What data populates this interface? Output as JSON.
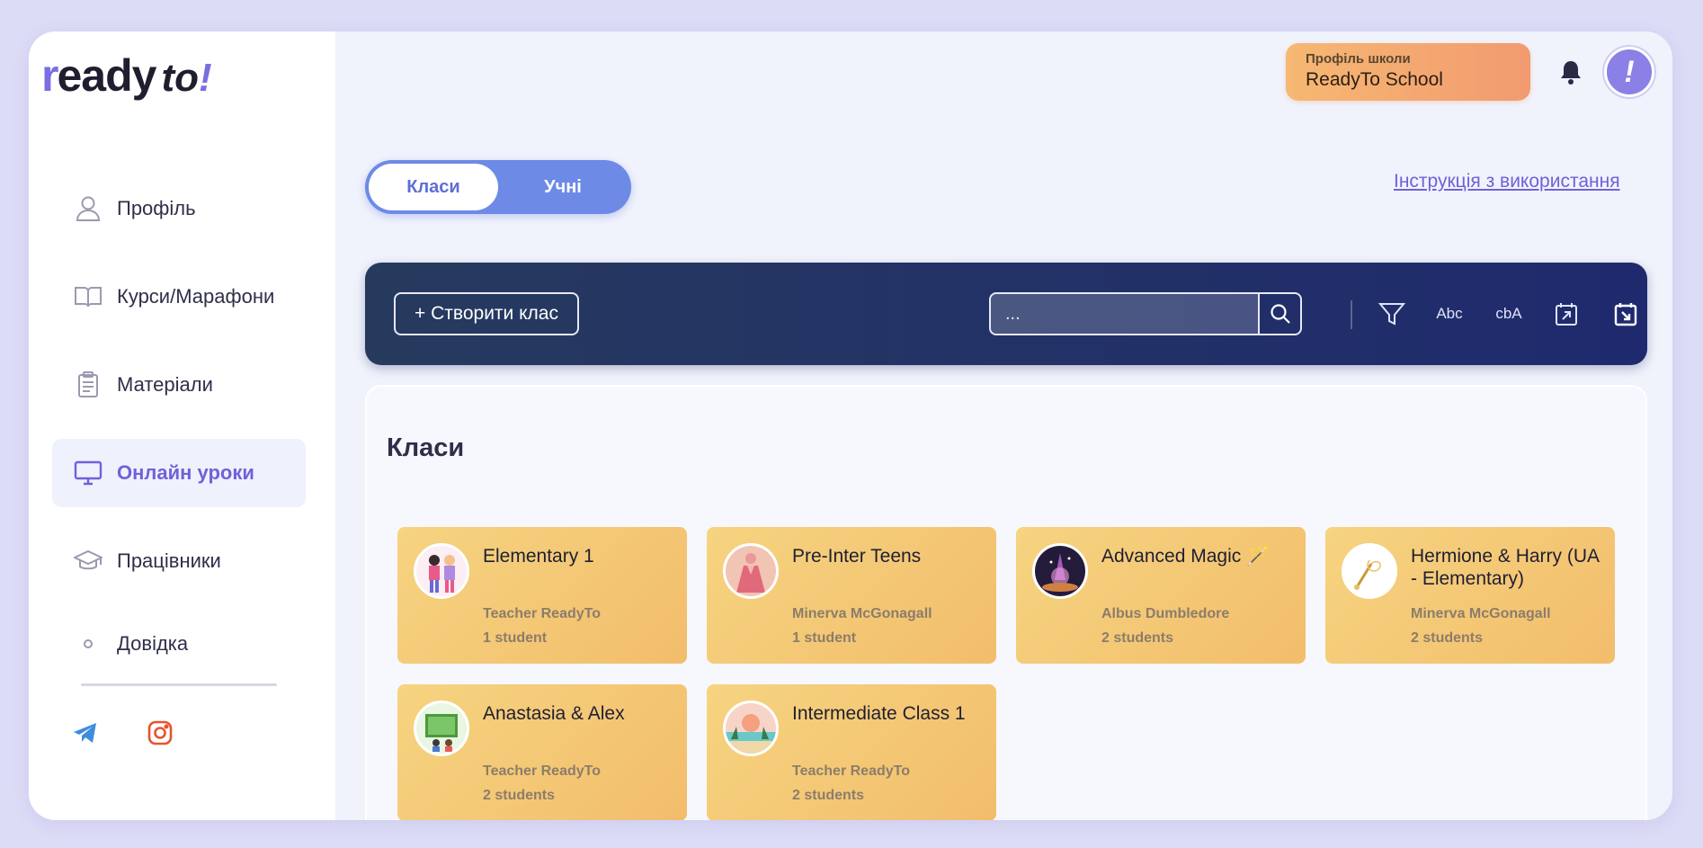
{
  "logo": {
    "r": "r",
    "eady": "eady",
    "to": "to",
    "ex": "!"
  },
  "sidebar": {
    "items": [
      {
        "label": "Профіль",
        "icon": "user-icon"
      },
      {
        "label": "Курси/Марафони",
        "icon": "book-icon"
      },
      {
        "label": "Матеріали",
        "icon": "clipboard-icon"
      },
      {
        "label": "Онлайн уроки",
        "icon": "monitor-icon",
        "active": true
      },
      {
        "label": "Працівники",
        "icon": "graduation-cap-icon"
      },
      {
        "label": "Довідка",
        "icon": "dot-icon"
      }
    ],
    "social": [
      "telegram-icon",
      "instagram-icon"
    ]
  },
  "header": {
    "school_sub": "Профіль школи",
    "school_name": "ReadyTo School",
    "avatar_letter": "!"
  },
  "toggle": {
    "classes": "Класи",
    "students": "Учні",
    "selected": "classes"
  },
  "guide_link": "Інструкція з використання",
  "toolbar": {
    "create_label": "+ Створити клас",
    "search_placeholder": "...",
    "sort_az": "Abc",
    "sort_za": "cbA"
  },
  "panel": {
    "title": "Класи",
    "cards": [
      {
        "name": "Elementary 1",
        "teacher": "Teacher ReadyTo",
        "count": "1 student",
        "thumb": "people"
      },
      {
        "name": "Pre-Inter Teens",
        "teacher": "Minerva McGonagall",
        "count": "1 student",
        "thumb": "dress"
      },
      {
        "name": "Advanced Magic 🪄",
        "teacher": "Albus Dumbledore",
        "count": "2 students",
        "thumb": "magic"
      },
      {
        "name": "Hermione & Harry (UA - Elementary)",
        "teacher": "Minerva McGonagall",
        "count": "2 students",
        "thumb": "wand"
      },
      {
        "name": "Anastasia & Alex",
        "teacher": "Teacher ReadyTo",
        "count": "2 students",
        "thumb": "board"
      },
      {
        "name": "Intermediate Class 1",
        "teacher": "Teacher ReadyTo",
        "count": "2 students",
        "thumb": "sunset"
      }
    ]
  },
  "colors": {
    "accent": "#6d63d8",
    "toolbar": "#1f2a6e",
    "card": "#f4c873",
    "badge": "#f29a70"
  }
}
